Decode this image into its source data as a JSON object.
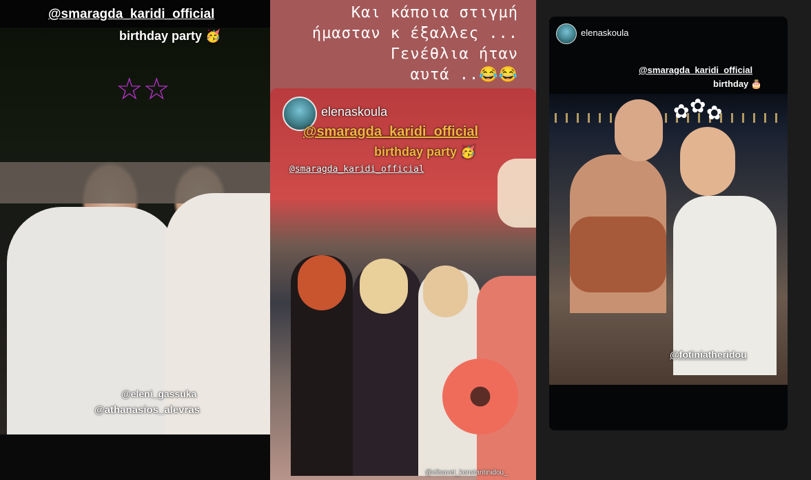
{
  "stories": [
    {
      "caption_mention": "@smaragda_karidi_official",
      "caption_text": "birthday party 🥳",
      "tag_1": "@eleni_gassuka",
      "tag_2": "@athanasios_alevras",
      "stars_icon": "☆☆"
    },
    {
      "text_line_1": "Και κάποια στιγμή",
      "text_line_2": "ήμασταν κ έξαλλες ...",
      "text_line_3": "Γενέθλια ήταν",
      "text_line_4": "αυτά ..😂😂",
      "username": "elenaskoula",
      "reshared_mention": "@smaragda_karidi_official",
      "reshared_caption": "birthday party 🥳",
      "mention_small": "@smaragda_karidi_official",
      "tag_bottom": "@elisavet_konstantinidou_"
    },
    {
      "username": "elenaskoula",
      "caption_mention": "@smaragda_karidi_official",
      "caption_text": "birthday 🎂",
      "tag": "@fotiniatheridou",
      "daisy_icon": "✿"
    }
  ]
}
